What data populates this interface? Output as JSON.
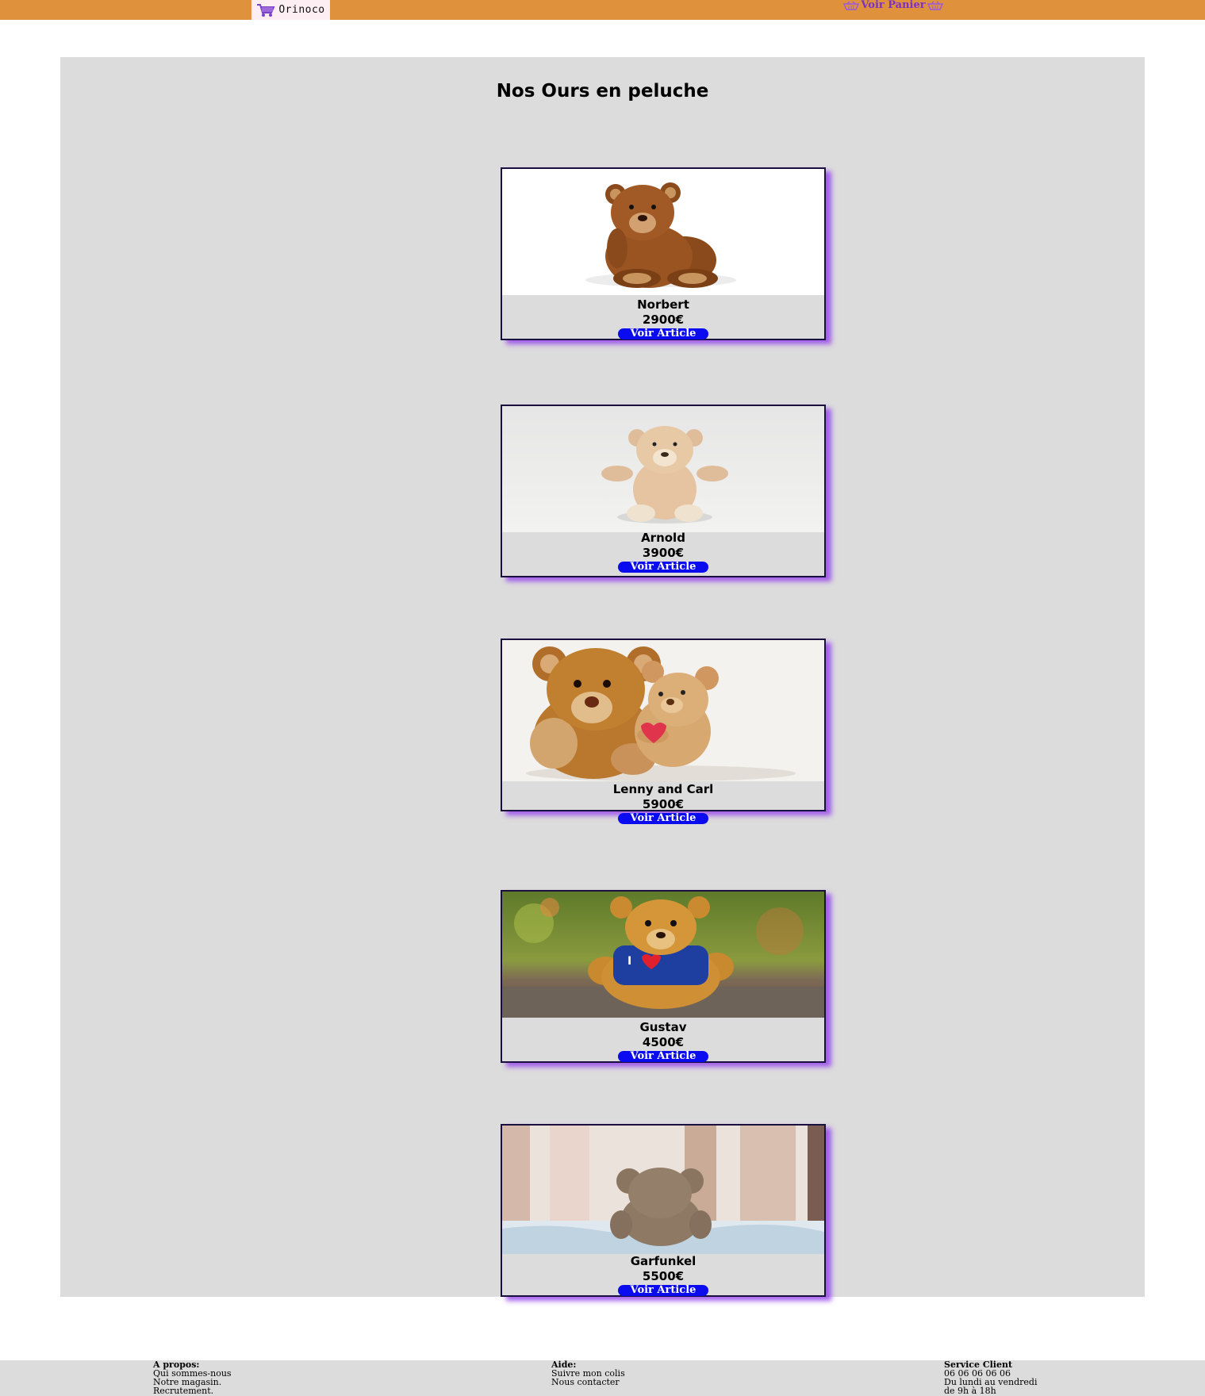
{
  "header": {
    "logo_text": "Orinoco",
    "cart_label": "Voir Panier",
    "colors": {
      "bar": "#e0913b",
      "cart_link": "#7a30c9"
    }
  },
  "main": {
    "title": "Nos Ours en peluche",
    "products": [
      {
        "name": "Norbert",
        "price": "2900€",
        "button": "Voir Article",
        "image": "brown-teddy-bear-photo"
      },
      {
        "name": "Arnold",
        "price": "3900€",
        "button": "Voir Article",
        "image": "beige-teddy-bear-photo"
      },
      {
        "name": "Lenny and Carl",
        "price": "5900€",
        "button": "Voir Article",
        "image": "two-teddy-bears-photo"
      },
      {
        "name": "Gustav",
        "price": "4500€",
        "button": "Voir Article",
        "image": "teddy-bear-blue-shirt-photo"
      },
      {
        "name": "Garfunkel",
        "price": "5500€",
        "button": "Voir Article",
        "image": "teddy-bear-window-photo"
      }
    ]
  },
  "footer": {
    "about": {
      "heading": "A propos:",
      "links": [
        "Qui sommes-nous",
        "Notre magasin.",
        "Recrutement."
      ]
    },
    "help": {
      "heading": "Aide:",
      "links": [
        "Suivre mon colis",
        "Nous contacter"
      ]
    },
    "service": {
      "heading": "Service Client",
      "lines": [
        "06 06 06 06 06",
        "Du lundi au vendredi",
        "de 9h à 18h"
      ]
    }
  }
}
